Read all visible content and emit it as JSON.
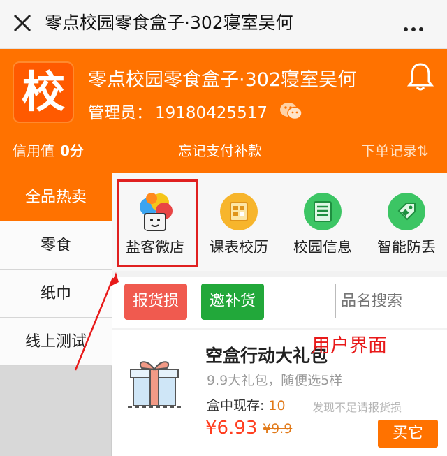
{
  "topbar": {
    "title": "零点校园零食盒子·302寝室吴何"
  },
  "header": {
    "logo_char": "校",
    "shop_name": "零点校园零食盒子·302寝室吴何",
    "admin_label": "管理员：",
    "admin_phone": "19180425517",
    "credit_label": "信用值",
    "credit_value": "0分",
    "forgot_pay": "忘记支付补款",
    "order_records": "下单记录⇅"
  },
  "sidebar": {
    "items": [
      {
        "label": "全品热卖"
      },
      {
        "label": "零食"
      },
      {
        "label": "纸巾"
      },
      {
        "label": "线上测试"
      }
    ]
  },
  "apps": [
    {
      "label": "盐客微店"
    },
    {
      "label": "课表校历"
    },
    {
      "label": "校园信息"
    },
    {
      "label": "智能防丢"
    }
  ],
  "actions": {
    "report_label": "报货损",
    "restock_label": "邀补货",
    "search_placeholder": "品名搜索"
  },
  "annotation": "用户界面",
  "product": {
    "name": "空盒行动大礼包",
    "desc": "9.9大礼包，随便选5样",
    "stock_label": "盒中现存:",
    "stock_value": "10",
    "warning": "发现不足请报货损",
    "price": "¥6.93",
    "original_price": "¥9.9",
    "buy_label": "买它"
  },
  "colors": {
    "accent": "#ff7200",
    "danger": "#f05a4f",
    "success": "#22a83a",
    "annotation": "#e81a1a"
  }
}
